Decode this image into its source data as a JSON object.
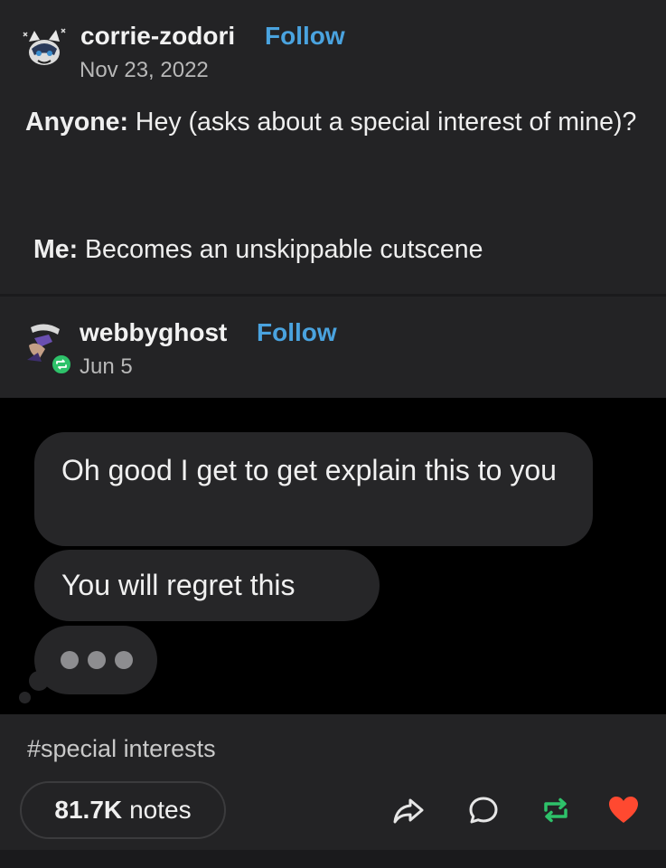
{
  "post1": {
    "username": "corrie-zodori",
    "follow_label": "Follow",
    "date": "Nov 23, 2022",
    "line1_speaker": "Anyone:",
    "line1_text": " Hey (asks about a special interest of mine)?",
    "line2_speaker": "Me:",
    "line2_text": " Becomes an unskippable cutscene"
  },
  "post2": {
    "username": "webbyghost",
    "follow_label": "Follow",
    "date": "Jun 5",
    "reblog_badge_icon": "reblog-icon"
  },
  "chat": {
    "bubble1": "Oh good I get to get explain this to you",
    "bubble2": "You will regret this",
    "typing_indicator": "typing-dots"
  },
  "footer": {
    "tags": "#special interests",
    "notes_count": "81.7K",
    "notes_label": "notes",
    "icons": [
      "share-icon",
      "comment-icon",
      "reblog-icon",
      "like-icon"
    ]
  },
  "colors": {
    "follow": "#4aa3df",
    "reblog": "#2ec26a",
    "like": "#ff4930"
  }
}
